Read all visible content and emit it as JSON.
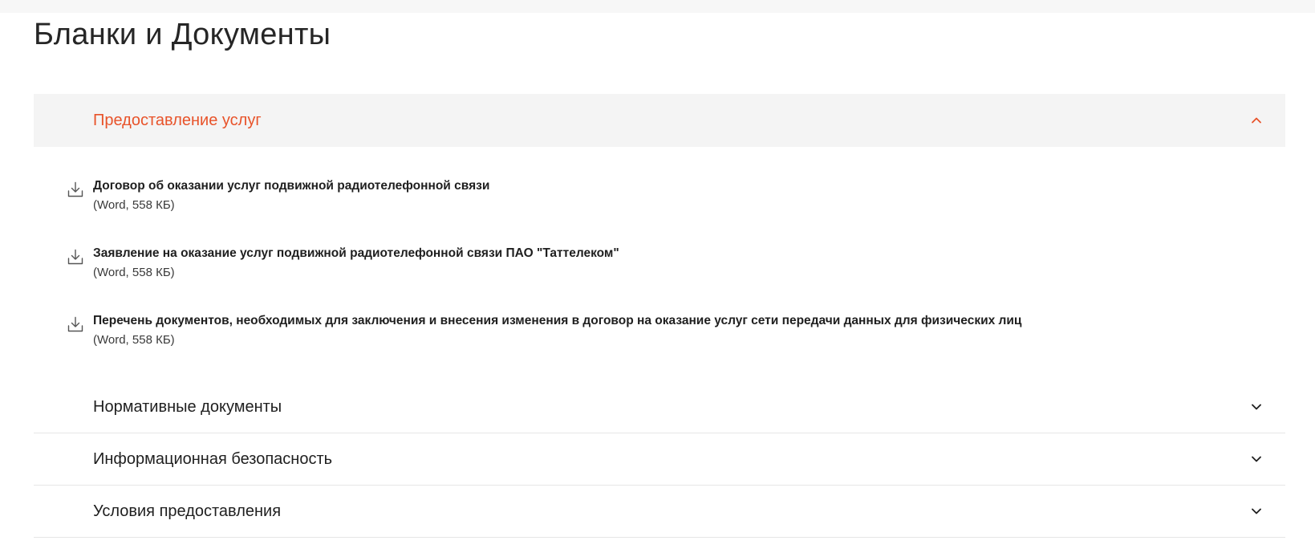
{
  "page": {
    "title": "Бланки и Документы"
  },
  "accordion": {
    "open_section": {
      "title": "Предоставление услуг",
      "chevron_icon": "chevron-up-icon",
      "documents": [
        {
          "title": "Договор об оказании услуг подвижной радиотелефонной связи",
          "meta": "(Word, 558 КБ)",
          "icon": "download-icon"
        },
        {
          "title": "Заявление на оказание услуг подвижной радиотелефонной связи ПАО \"Таттелеком\"",
          "meta": "(Word, 558 КБ)",
          "icon": "download-icon"
        },
        {
          "title": "Перечень документов, необходимых для заключения и внесения изменения в договор на оказание услуг сети передачи данных для физических лиц",
          "meta": "(Word, 558 КБ)",
          "icon": "download-icon"
        }
      ]
    },
    "collapsed_sections": [
      {
        "title": "Нормативные документы",
        "chevron_icon": "chevron-down-icon"
      },
      {
        "title": "Информационная безопасность",
        "chevron_icon": "chevron-down-icon"
      },
      {
        "title": "Условия предоставления",
        "chevron_icon": "chevron-down-icon"
      }
    ]
  },
  "colors": {
    "accent": "#e8532a",
    "open_header_bg": "#f4f4f4",
    "divider": "#e6e6e6",
    "text": "#1f1f1f"
  }
}
